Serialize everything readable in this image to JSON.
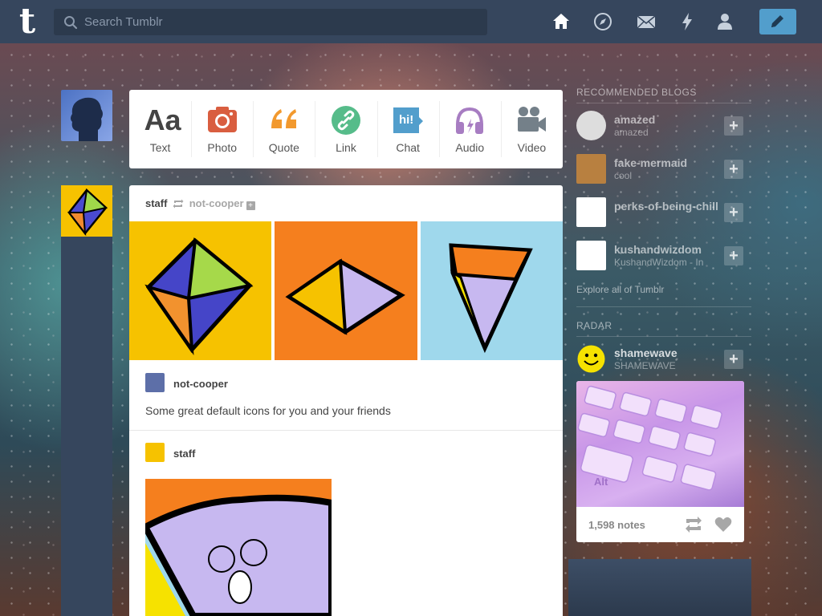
{
  "navbar": {
    "logo": "t",
    "search_placeholder": "Search Tumblr",
    "icons": [
      "home-icon",
      "explore-icon",
      "inbox-icon",
      "activity-icon",
      "account-icon"
    ],
    "compose_icon": "pencil-icon"
  },
  "post_types": [
    {
      "label": "Text",
      "icon": "text-icon",
      "glyph": "Aa",
      "color": "#444444"
    },
    {
      "label": "Photo",
      "icon": "camera-icon",
      "color": "#d95e40"
    },
    {
      "label": "Quote",
      "icon": "quote-icon",
      "color": "#f2992e"
    },
    {
      "label": "Link",
      "icon": "link-icon",
      "color": "#56bc8a"
    },
    {
      "label": "Chat",
      "icon": "chat-icon",
      "glyph": "hi!",
      "color": "#529ecc"
    },
    {
      "label": "Audio",
      "icon": "headphones-icon",
      "color": "#a77dc2"
    },
    {
      "label": "Video",
      "icon": "video-camera-icon",
      "color": "#748089"
    }
  ],
  "post": {
    "author": "staff",
    "reblogged_from": "not-cooper",
    "reblog_user": "not-cooper",
    "reblog_text": "Some great default icons for you and your friends",
    "second_user": "staff"
  },
  "sidebar": {
    "recommended_heading": "RECOMMENDED BLOGS",
    "recommended": [
      {
        "name": "amazed",
        "sub": "amazed"
      },
      {
        "name": "fake-mermaid",
        "sub": "cool"
      },
      {
        "name": "perks-of-being-chill",
        "sub": ""
      },
      {
        "name": "kushandwizdom",
        "sub": "KushandWizdom - In"
      }
    ],
    "explore_link": "Explore all of Tumblr",
    "radar_heading": "RADAR",
    "radar_user": {
      "name": "shamewave",
      "sub": "SHAMEWAVE"
    },
    "radar_notes": "1,598 notes",
    "radar_key_label": "Alt"
  }
}
